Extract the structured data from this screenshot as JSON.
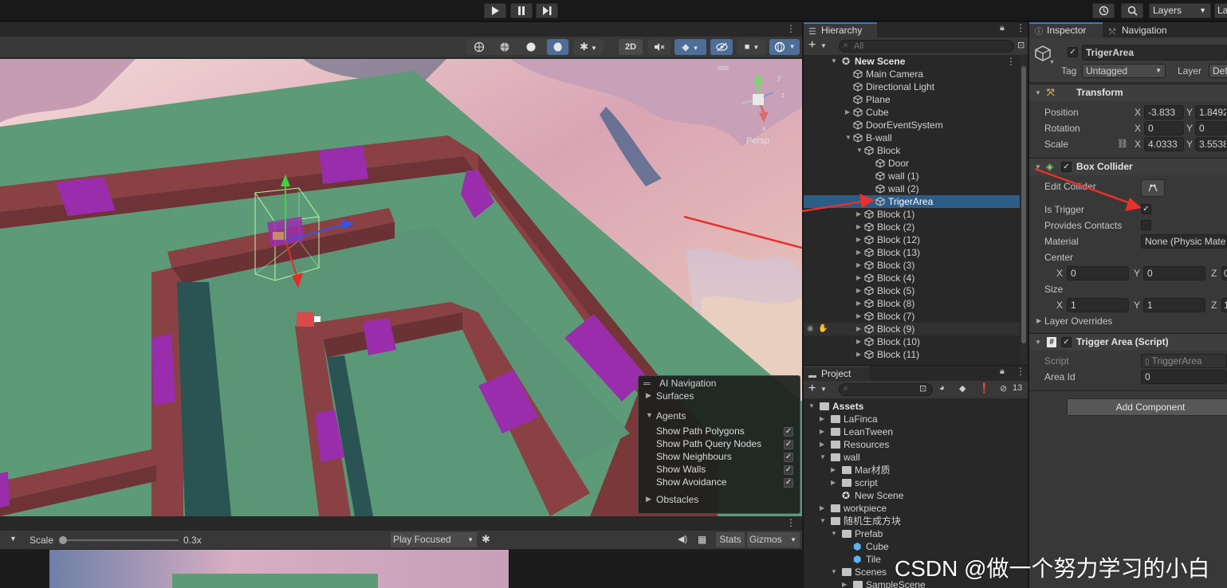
{
  "toolbar": {
    "play_icon": "play-icon",
    "pause_icon": "pause-icon",
    "step_icon": "step-icon",
    "history_icon": "history-icon",
    "search_icon": "search-icon",
    "layers_label": "Layers",
    "layout_label": "Lay"
  },
  "scene": {
    "mode_2d": "2D",
    "gizmo_labels": {
      "y": "y",
      "z": "z",
      "x": "x"
    },
    "persp_label": "Persp"
  },
  "ai_navigation": {
    "title": "AI Navigation",
    "surfaces": "Surfaces",
    "agents": "Agents",
    "options": [
      {
        "label": "Show Path Polygons",
        "checked": true
      },
      {
        "label": "Show Path Query Nodes",
        "checked": true
      },
      {
        "label": "Show Neighbours",
        "checked": true
      },
      {
        "label": "Show Walls",
        "checked": true
      },
      {
        "label": "Show Avoidance",
        "checked": true
      }
    ],
    "obstacles": "Obstacles",
    "check_mark": "✓"
  },
  "game": {
    "scale_label": "Scale",
    "scale_value": "0.3x",
    "scale_fraction": 0.0,
    "play_focused": "Play Focused",
    "stats": "Stats",
    "gizmos": "Gizmos"
  },
  "hierarchy": {
    "tab_label": "Hierarchy",
    "search_placeholder": "All",
    "scene_name": "New Scene",
    "items": [
      {
        "label": "Main Camera",
        "depth": 1,
        "fold": ""
      },
      {
        "label": "Directional Light",
        "depth": 1,
        "fold": ""
      },
      {
        "label": "Plane",
        "depth": 1,
        "fold": ""
      },
      {
        "label": "Cube",
        "depth": 1,
        "fold": "▶"
      },
      {
        "label": "DoorEventSystem",
        "depth": 1,
        "fold": ""
      },
      {
        "label": "B-wall",
        "depth": 1,
        "fold": "▼"
      },
      {
        "label": "Block",
        "depth": 2,
        "fold": "▼"
      },
      {
        "label": "Door",
        "depth": 3,
        "fold": ""
      },
      {
        "label": "wall (1)",
        "depth": 3,
        "fold": ""
      },
      {
        "label": "wall (2)",
        "depth": 3,
        "fold": ""
      },
      {
        "label": "TrigerArea",
        "depth": 3,
        "fold": "",
        "selected": true
      },
      {
        "label": "Block (1)",
        "depth": 2,
        "fold": "▶"
      },
      {
        "label": "Block (2)",
        "depth": 2,
        "fold": "▶"
      },
      {
        "label": "Block (12)",
        "depth": 2,
        "fold": "▶"
      },
      {
        "label": "Block (13)",
        "depth": 2,
        "fold": "▶"
      },
      {
        "label": "Block (3)",
        "depth": 2,
        "fold": "▶"
      },
      {
        "label": "Block (4)",
        "depth": 2,
        "fold": "▶"
      },
      {
        "label": "Block (5)",
        "depth": 2,
        "fold": "▶"
      },
      {
        "label": "Block (8)",
        "depth": 2,
        "fold": "▶"
      },
      {
        "label": "Block (7)",
        "depth": 2,
        "fold": "▶"
      },
      {
        "label": "Block (9)",
        "depth": 2,
        "fold": "▶",
        "hover": true
      },
      {
        "label": "Block (10)",
        "depth": 2,
        "fold": "▶"
      },
      {
        "label": "Block (11)",
        "depth": 2,
        "fold": "▶"
      }
    ]
  },
  "project": {
    "tab_label": "Project",
    "hidden_count": "13",
    "items": [
      {
        "label": "Assets",
        "depth": 0,
        "fold": "▼",
        "kind": "folder",
        "bold": true
      },
      {
        "label": "LaFinca",
        "depth": 1,
        "fold": "▶",
        "kind": "folder"
      },
      {
        "label": "LeanTween",
        "depth": 1,
        "fold": "▶",
        "kind": "folder"
      },
      {
        "label": "Resources",
        "depth": 1,
        "fold": "▶",
        "kind": "folder"
      },
      {
        "label": "wall",
        "depth": 1,
        "fold": "▼",
        "kind": "folder"
      },
      {
        "label": "Mar材质",
        "depth": 2,
        "fold": "▶",
        "kind": "folder"
      },
      {
        "label": "script",
        "depth": 2,
        "fold": "▶",
        "kind": "folder"
      },
      {
        "label": "New Scene",
        "depth": 2,
        "fold": "",
        "kind": "scene"
      },
      {
        "label": "workpiece",
        "depth": 1,
        "fold": "▶",
        "kind": "folder"
      },
      {
        "label": "随机生成方块",
        "depth": 1,
        "fold": "▼",
        "kind": "folder"
      },
      {
        "label": "Prefab",
        "depth": 2,
        "fold": "▼",
        "kind": "folder"
      },
      {
        "label": "Cube",
        "depth": 3,
        "fold": "",
        "kind": "prefab"
      },
      {
        "label": "Tile",
        "depth": 3,
        "fold": "",
        "kind": "prefab"
      },
      {
        "label": "Scenes",
        "depth": 2,
        "fold": "▼",
        "kind": "folder"
      },
      {
        "label": "SampleScene",
        "depth": 3,
        "fold": "▶",
        "kind": "folder"
      }
    ]
  },
  "inspector": {
    "tab_label": "Inspector",
    "nav_tab_label": "Navigation",
    "object_name": "TrigerArea",
    "tag_label": "Tag",
    "tag_value": "Untagged",
    "layer_label": "Layer",
    "layer_value": "Def",
    "transform": {
      "title": "Transform",
      "position_label": "Position",
      "position": {
        "x": "-3.833",
        "y": "1.8492"
      },
      "rotation_label": "Rotation",
      "rotation": {
        "x": "0",
        "y": "0"
      },
      "scale_label": "Scale",
      "scale": {
        "x": "4.0333",
        "y": "3.5538"
      }
    },
    "box_collider": {
      "title": "Box Collider",
      "edit_collider": "Edit Collider",
      "is_trigger": "Is Trigger",
      "is_trigger_checked": true,
      "provides_contacts": "Provides Contacts",
      "material_label": "Material",
      "material_value": "None (Physic Mate",
      "center_label": "Center",
      "center": {
        "x": "0",
        "y": "0",
        "z": "0"
      },
      "size_label": "Size",
      "size": {
        "x": "1",
        "y": "1",
        "z": "1"
      },
      "layer_overrides": "Layer Overrides"
    },
    "trigger_script": {
      "title": "Trigger Area (Script)",
      "script_label": "Script",
      "script_value": "TriggerArea",
      "area_id_label": "Area Id",
      "area_id_value": "0"
    },
    "add_component": "Add Component",
    "axis": {
      "x": "X",
      "y": "Y",
      "z": "Z"
    }
  },
  "watermark": "CSDN @做一个努力学习的小白",
  "colors": {
    "accent": "#3a79bb",
    "selection": "#2c5d87",
    "annotation_arrow": "#e8312a",
    "ground": "#5d9b78",
    "wall": "#7f3b3e",
    "wall_highlight": "#9a2dab"
  }
}
